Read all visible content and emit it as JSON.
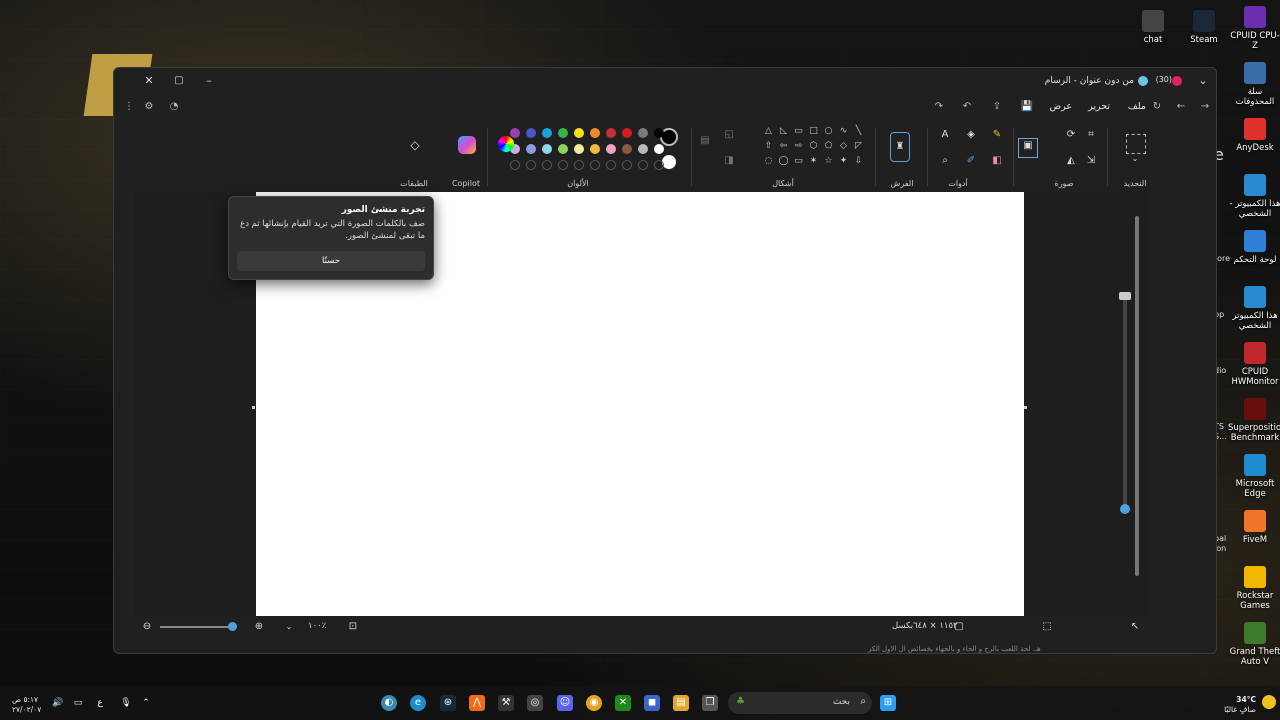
{
  "window": {
    "title": "من دون عنوان - الرسام",
    "badge": "(30)",
    "minimize_icon": "minimize-icon",
    "maximize_icon": "maximize-icon",
    "close_icon": "close-icon"
  },
  "menu": {
    "file": "ملف",
    "edit": "تحرير",
    "view": "عرض"
  },
  "ribbon": {
    "selection": "التحديد",
    "image": "صورة",
    "tools": "أدوات",
    "brushes": "الفرش",
    "shapes": "أشكال",
    "colors": "الألوان",
    "copilot": "Copilot",
    "layers": "الطبقات"
  },
  "palette": {
    "row1": [
      "#000000",
      "#7a7a7a",
      "#d61a1f",
      "#c62f3a",
      "#f0892c",
      "#f7e018",
      "#34b34a",
      "#1aa0d8",
      "#4b55c8",
      "#9b3fb5"
    ],
    "row2": [
      "#ffffff",
      "#b8b8b8",
      "#8a5a3c",
      "#f2a3c0",
      "#f4b93a",
      "#f2eb9e",
      "#8ed05c",
      "#8ad8e8",
      "#8d9be0",
      "#c8b0e0"
    ],
    "current_fg": "#000000",
    "current_bg": "#ffffff"
  },
  "popup": {
    "title": "تجربة منشئ الصور",
    "body": "صف بالكلمات الصورة التي تريد القيام بإنشائها ثم دع ما تبقى لمنشئ الصور.",
    "button": "حسنًا"
  },
  "status": {
    "canvas_size": "١١٥٢ × ٦٤٨بكسل",
    "zoom": "١٠٠٪"
  },
  "desktop": {
    "icons": [
      {
        "label": "chat",
        "color": "#444"
      },
      {
        "label": "Steam",
        "color": "#1b2838"
      },
      {
        "label": "CPUID CPU-Z",
        "color": "#6a2fb0"
      },
      {
        "label": "سلة المحذوفات",
        "color": "#3a6ea8"
      },
      {
        "label": "AnyDesk",
        "color": "#e0312c"
      },
      {
        "label": "هذا الكمبيوتر - الشخصي",
        "color": "#2a8ad0"
      },
      {
        "label": "لوحة التحكم",
        "color": "#2e7fd6"
      },
      {
        "label": "هذا الكمبيوتر الشخصي",
        "color": "#2a8ad0"
      },
      {
        "label": "CPUID HWMonitor",
        "color": "#c0282e"
      },
      {
        "label": "Superposition Benchmark",
        "color": "#6a0d0d"
      },
      {
        "label": "Microsoft Edge",
        "color": "#1f8bd0"
      },
      {
        "label": "FiveM",
        "color": "#f0762a"
      },
      {
        "label": "Rockstar Games",
        "color": "#f2b800"
      },
      {
        "label": "Grand Theft Auto V",
        "color": "#3d7a2a"
      }
    ],
    "partials": [
      "e",
      "tore",
      "pp",
      "dio",
      "TS",
      "S...",
      "bal",
      "ion"
    ]
  },
  "taskbar": {
    "search_placeholder": "بحث",
    "weather_temp": "34°C",
    "weather_desc": "صافٍ غالبًا",
    "time": "٥:١٧ ص",
    "date": "٢٧/٠٢/٠٧",
    "lang": "ع"
  },
  "footer_hint": "هـ. لحة اللعب بالرح و الحاء و بالحهاء بخصائص ال الاول الكر"
}
